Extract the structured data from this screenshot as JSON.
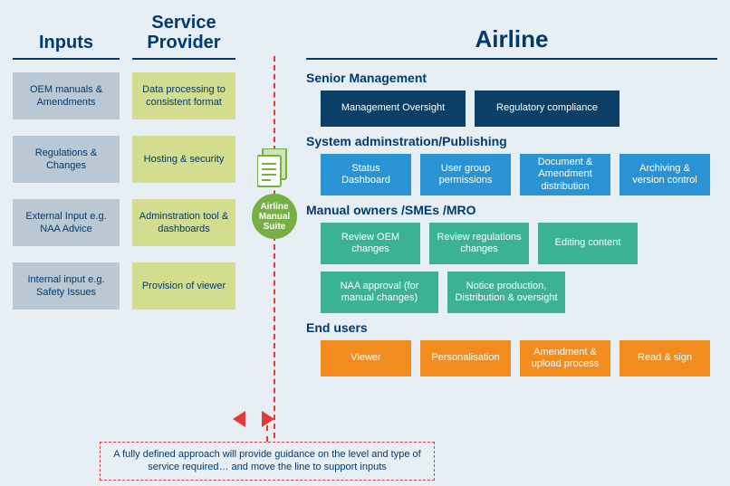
{
  "titles": {
    "inputs": "Inputs",
    "provider": "Service Provider",
    "airline": "Airline"
  },
  "inputs": [
    "OEM manuals & Amendments",
    "Regulations & Changes",
    "External Input e.g. NAA Advice",
    "Internal input e.g. Safety Issues"
  ],
  "provider": [
    "Data processing to consistent format",
    "Hosting & security",
    "Adminstration tool & dashboards",
    "Provision of viewer"
  ],
  "suite_label": "Airline Manual Suite",
  "sections": {
    "senior": {
      "title": "Senior Management",
      "items": [
        "Management Oversight",
        "Regulatory compliance"
      ]
    },
    "system": {
      "title": "System adminstration/Publishing",
      "items": [
        "Status Dashboard",
        "User group permissions",
        "Document & Amendment distribution",
        "Archiving & version control"
      ]
    },
    "owners": {
      "title": "Manual owners /SMEs /MRO",
      "row1": [
        "Review OEM changes",
        "Review regulations changes",
        "Editing content"
      ],
      "row2": [
        "NAA approval (for manual changes)",
        "Notice production, Distribution & oversight"
      ]
    },
    "end": {
      "title": "End users",
      "items": [
        "Viewer",
        "Personalisation",
        "Amendment & upload process",
        "Read & sign"
      ]
    }
  },
  "footnote": "A fully defined approach will provide guidance on the level and type of service required… and move the line to support inputs"
}
